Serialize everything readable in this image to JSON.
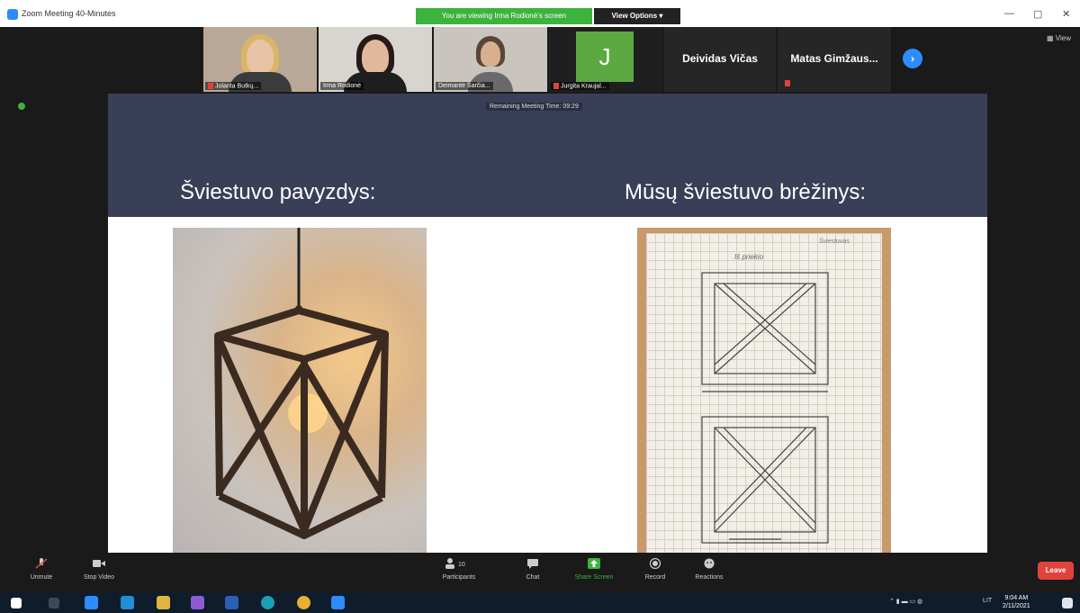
{
  "window": {
    "title": "Zoom Meeting 40-Minutes",
    "share_banner": "You are viewing Irma Rodionė's screen",
    "view_options": "View Options ▾",
    "minimize": "—",
    "restore": "▢",
    "close": "✕"
  },
  "participants_strip": {
    "thumbnails": [
      {
        "name": "Jolanta Butkų..."
      },
      {
        "name": "Irma Rodionė"
      },
      {
        "name": "Deimantė Šarčia..."
      },
      {
        "name": "Jurgita Kraujal...",
        "initial": "J"
      }
    ],
    "name_only": [
      {
        "name": "Deividas Vičas"
      },
      {
        "name": "Matas Gimžaus..."
      }
    ],
    "next_icon": "›",
    "view_label": "▦ View"
  },
  "slide": {
    "remaining_time": "Remaining Meeting Time: 09:29",
    "heading_left": "Šviestuvo pavyzdys:",
    "heading_right": "Mūsų šviestuvo brėžinys:",
    "drawing_note": "Šviestuvas",
    "drawing_label": "Iš priekio"
  },
  "toolbar": {
    "unmute": "Unmute",
    "stop_video": "Stop Video",
    "participants": "Participants",
    "participants_count": "10",
    "chat": "Chat",
    "share_screen": "Share Screen",
    "record": "Record",
    "reactions": "Reactions",
    "leave": "Leave"
  },
  "taskbar": {
    "lang": "LIT",
    "time": "9:04 AM",
    "date": "2/11/2021"
  },
  "colors": {
    "slide_header": "#3a3f58",
    "share_green": "#3cb33c",
    "zoom_blue": "#2d8cff",
    "leave_red": "#e0433c"
  }
}
